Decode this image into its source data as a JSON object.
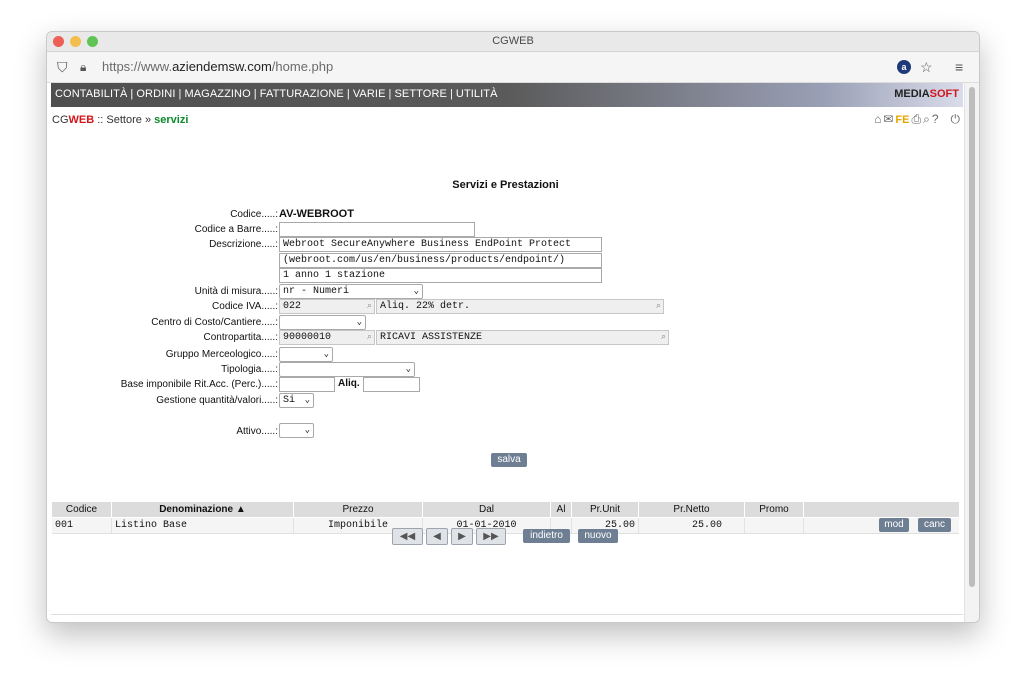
{
  "window": {
    "title": "CGWEB"
  },
  "browser": {
    "url_prefix": "https://www.",
    "url_domain": "aziendemsw.com",
    "url_path": "/home.php"
  },
  "menu": {
    "items": [
      "CONTABILITÀ",
      "ORDINI",
      "MAGAZZINO",
      "FATTURAZIONE",
      "VARIE",
      "SETTORE",
      "UTILITÀ"
    ],
    "separator": "|",
    "brand_a": "MEDIA",
    "brand_b": "SOFT"
  },
  "breadcrumb": {
    "cg": "CG",
    "web": "WEB",
    "sep1": "::",
    "section": "Settore",
    "sep2": "»",
    "current": "servizi"
  },
  "toolbar_icons": {
    "fe": "FE"
  },
  "page": {
    "title": "Servizi e Prestazioni"
  },
  "form": {
    "codice_label": "Codice.....:",
    "codice_value": "AV-WEBROOT",
    "barre_label": "Codice a Barre.....:",
    "barre_value": "",
    "descr_label": "Descrizione.....:",
    "descr_1": "Webroot SecureAnywhere Business EndPoint Protect",
    "descr_2": "(webroot.com/us/en/business/products/endpoint/)",
    "descr_3": "1 anno 1 stazione",
    "um_label": "Unità di misura.....:",
    "um_value": "nr - Numeri",
    "iva_label": "Codice IVA.....:",
    "iva_code": "022",
    "iva_desc": "Aliq. 22% detr.",
    "centro_label": "Centro di Costo/Cantiere.....:",
    "centro_value": "",
    "contro_label": "Contropartita.....:",
    "contro_code": "90000010",
    "contro_desc": "RICAVI ASSISTENZE",
    "gruppo_label": "Gruppo Merceologico.....:",
    "gruppo_value": "",
    "tipologia_label": "Tipologia.....:",
    "tipologia_value": "",
    "base_label": "Base imponibile Rit.Acc. (Perc.).....:",
    "base_value": "",
    "aliq_label": "Aliq.",
    "aliq_value": "",
    "gestione_label": "Gestione quantità/valori.....:",
    "gestione_value": "Si",
    "attivo_label": "Attivo.....:",
    "attivo_value": "",
    "save_label": "salva"
  },
  "table": {
    "headers": [
      "Codice",
      "Denominazione ▲",
      "Prezzo",
      "Dal",
      "Al",
      "Pr.Unit",
      "Pr.Netto",
      "Promo"
    ],
    "rows": [
      {
        "codice": "001",
        "denominazione": "Listino Base",
        "prezzo": "Imponibile",
        "dal": "01-01-2010",
        "al": "",
        "pr_unit": "25.00",
        "pr_netto": "25.00",
        "promo": "",
        "mod": "mod",
        "canc": "canc"
      }
    ]
  },
  "pager": {
    "first": "◀◀",
    "prev": "◀",
    "next": "▶",
    "last": "▶▶",
    "back": "indietro",
    "new": "nuovo"
  }
}
